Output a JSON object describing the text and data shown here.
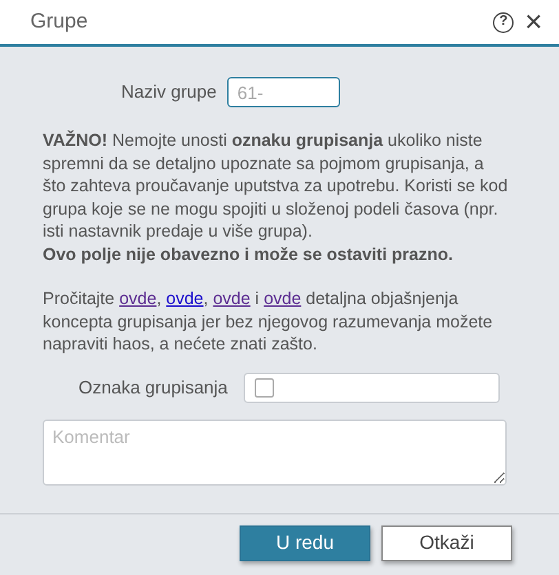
{
  "window": {
    "title": "Grupe",
    "help_icon": "?",
    "close_icon": "×"
  },
  "name_field": {
    "label": "Naziv grupe",
    "placeholder": "61-"
  },
  "warning": "**VAŽNO!** Nemojte unosti **oznaku grupisanja** ukoliko niste spremni da se detaljno upoznate sa pojmom grupisanja, a što zahteva proučavanje uputstva za upotrebu. Koristi se kod grupa koje se ne mogu spojiti u složenoj podeli časova (npr. isti nastavnik predaje u više grupa).",
  "note": "Ovo polje nije obavezno i može se ostaviti prazno.",
  "info": [
    {
      "kind": "text",
      "text": "Pročitajte "
    },
    {
      "kind": "link",
      "text": "ovde",
      "visited": true
    },
    {
      "kind": "text",
      "text": ", "
    },
    {
      "kind": "link",
      "text": "ovde",
      "visited": false
    },
    {
      "kind": "text",
      "text": ", "
    },
    {
      "kind": "link",
      "text": "ovde",
      "visited": true
    },
    {
      "kind": "text",
      "text": " i "
    },
    {
      "kind": "link",
      "text": "ovde",
      "visited": true
    },
    {
      "kind": "text",
      "text": " detaljna objašnjenja koncepta grupisanja jer bez njegovog razumevanja možete napraviti haos, a nećete znati zašto."
    }
  ],
  "grouping_field": {
    "label": "Oznaka grupisanja",
    "checked": false
  },
  "comment": {
    "placeholder": "Komentar"
  },
  "buttons": [
    {
      "label": "U redu",
      "kind": "primary"
    },
    {
      "label": "Otkaži",
      "kind": "secondary"
    }
  ]
}
